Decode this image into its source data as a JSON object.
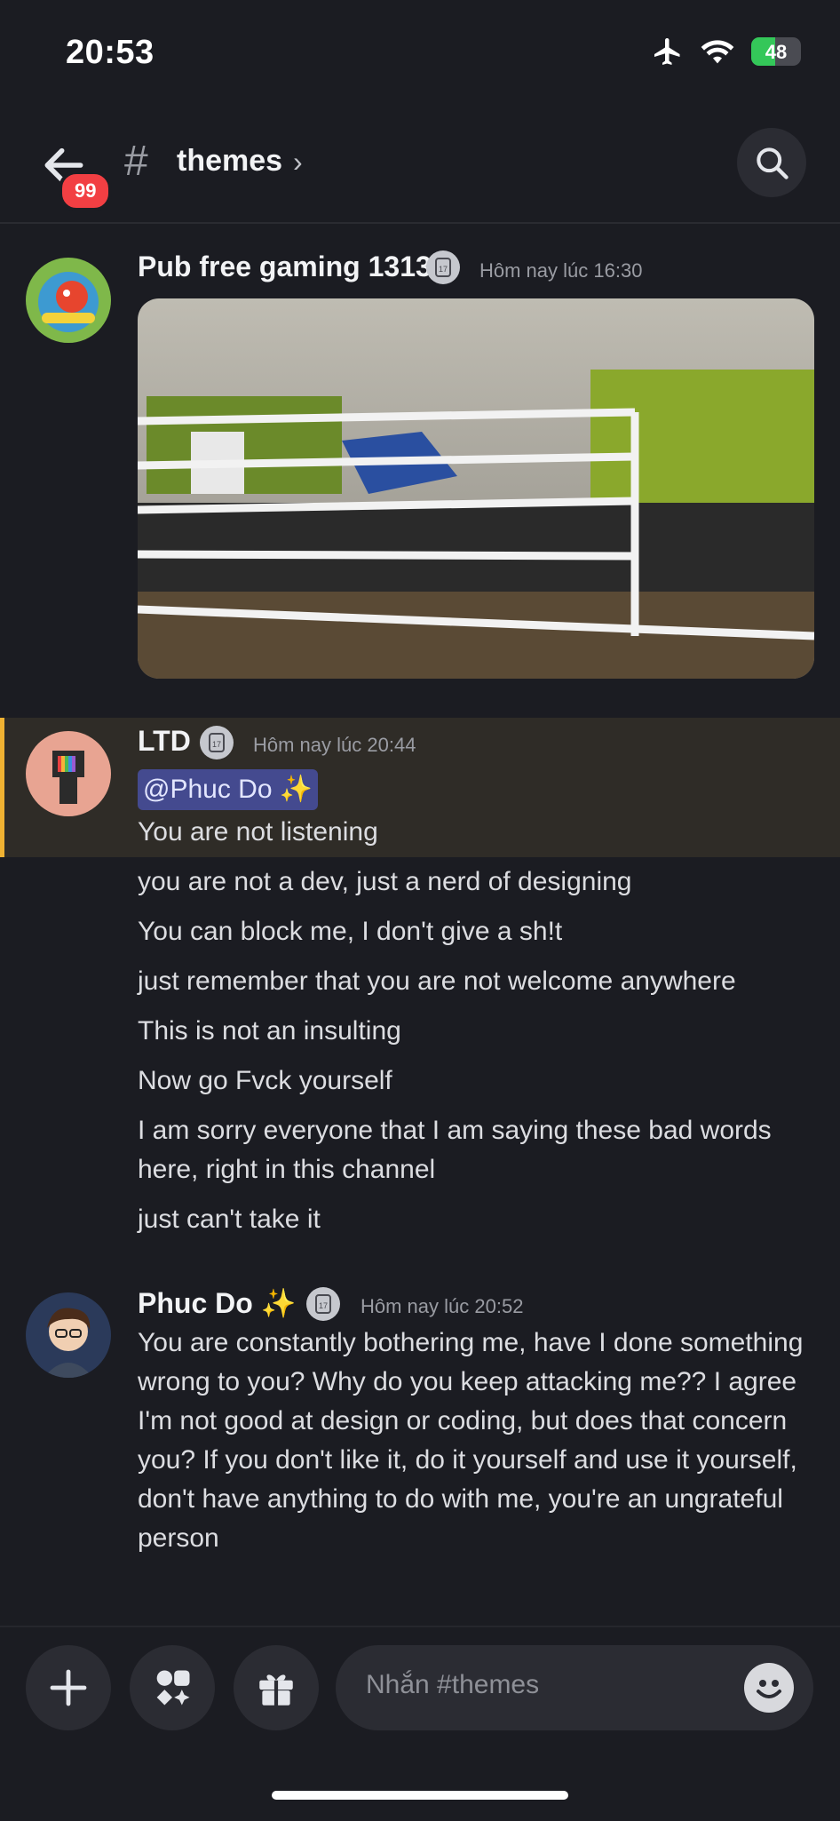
{
  "status_bar": {
    "time": "20:53",
    "battery": "48",
    "battery_level": 0.48
  },
  "header": {
    "unread_badge": "99",
    "channel_name": "themes",
    "chevron": "›"
  },
  "messages": [
    {
      "username": "Pub free gaming 1313",
      "timestamp": "Hôm nay lúc 16:30",
      "attachment": "photo"
    },
    {
      "username": "LTD",
      "timestamp": "Hôm nay lúc 20:44",
      "mention": "@Phuc Do ✨",
      "lines": [
        "You are not listening",
        "you are not a dev, just a nerd of designing",
        "You can block me, I don't give a sh!t",
        "just remember that you are not welcome anywhere",
        "This is not an insulting",
        "Now go Fvck yourself",
        "I am sorry everyone that I am saying these bad words here, right in this channel",
        "just can't take it"
      ]
    },
    {
      "username": "Phuc Do ✨",
      "timestamp": "Hôm nay lúc 20:52",
      "text": "You are constantly bothering me, have I done something wrong to you? Why do you keep attacking me?? I agree I'm not good at design or coding, but does that concern you? If you don't like it, do it yourself and use it yourself, don't have anything to do with me, you're an ungrateful person"
    }
  ],
  "composer": {
    "placeholder": "Nhắn #themes"
  },
  "icons": [
    "airplane-icon",
    "wifi-icon",
    "back-arrow-icon",
    "hash-icon",
    "search-icon",
    "plus-icon",
    "apps-icon",
    "gift-icon",
    "emoji-icon",
    "clock-badge-icon"
  ],
  "colors": {
    "background": "#1b1c22",
    "mention_bg": "#444a8f",
    "highlight_bar": "#f0b232",
    "badge": "#f23f43"
  }
}
